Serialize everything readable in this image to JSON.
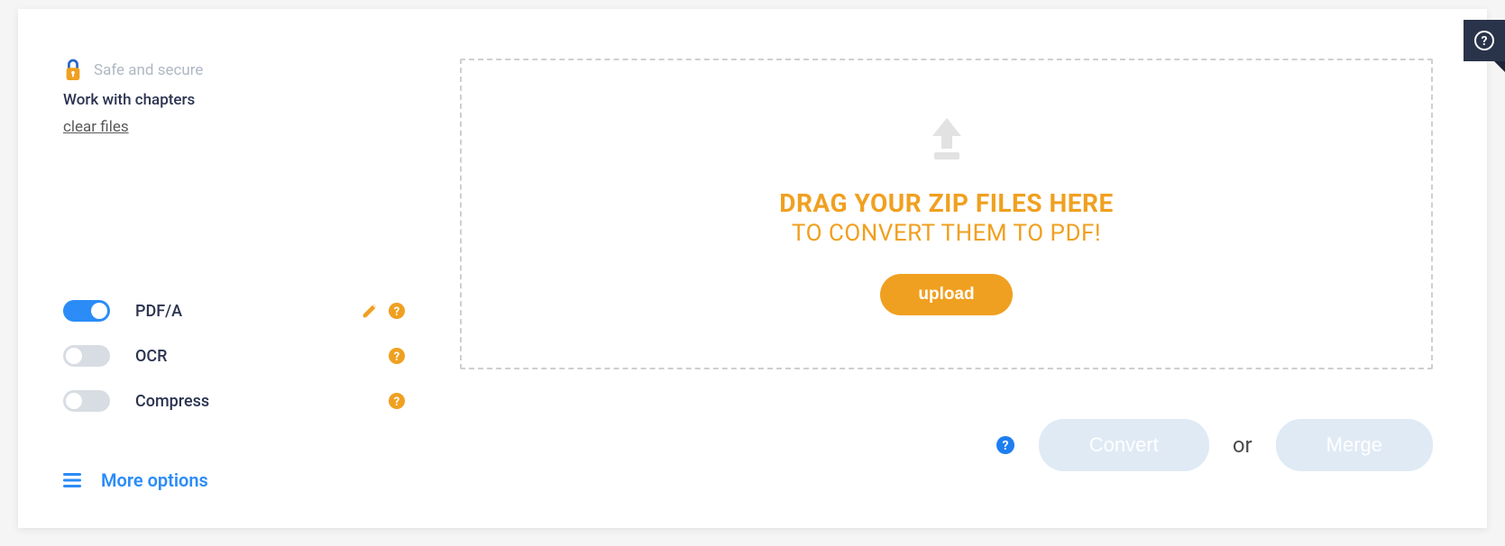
{
  "sidebar": {
    "safe_text": "Safe and secure",
    "chapters_text": "Work with chapters",
    "clear_files": "clear files"
  },
  "toggles": [
    {
      "label": "PDF/A",
      "on": true,
      "edit": true
    },
    {
      "label": "OCR",
      "on": false,
      "edit": false
    },
    {
      "label": "Compress",
      "on": false,
      "edit": false
    }
  ],
  "more_options": "More options",
  "dropzone": {
    "title": "DRAG YOUR ZIP FILES HERE",
    "subtitle": "TO CONVERT THEM TO PDF!",
    "upload_label": "upload"
  },
  "actions": {
    "convert": "Convert",
    "or": "or",
    "merge": "Merge"
  },
  "colors": {
    "accent_orange": "#f0a020",
    "accent_blue": "#2b8cf7"
  }
}
